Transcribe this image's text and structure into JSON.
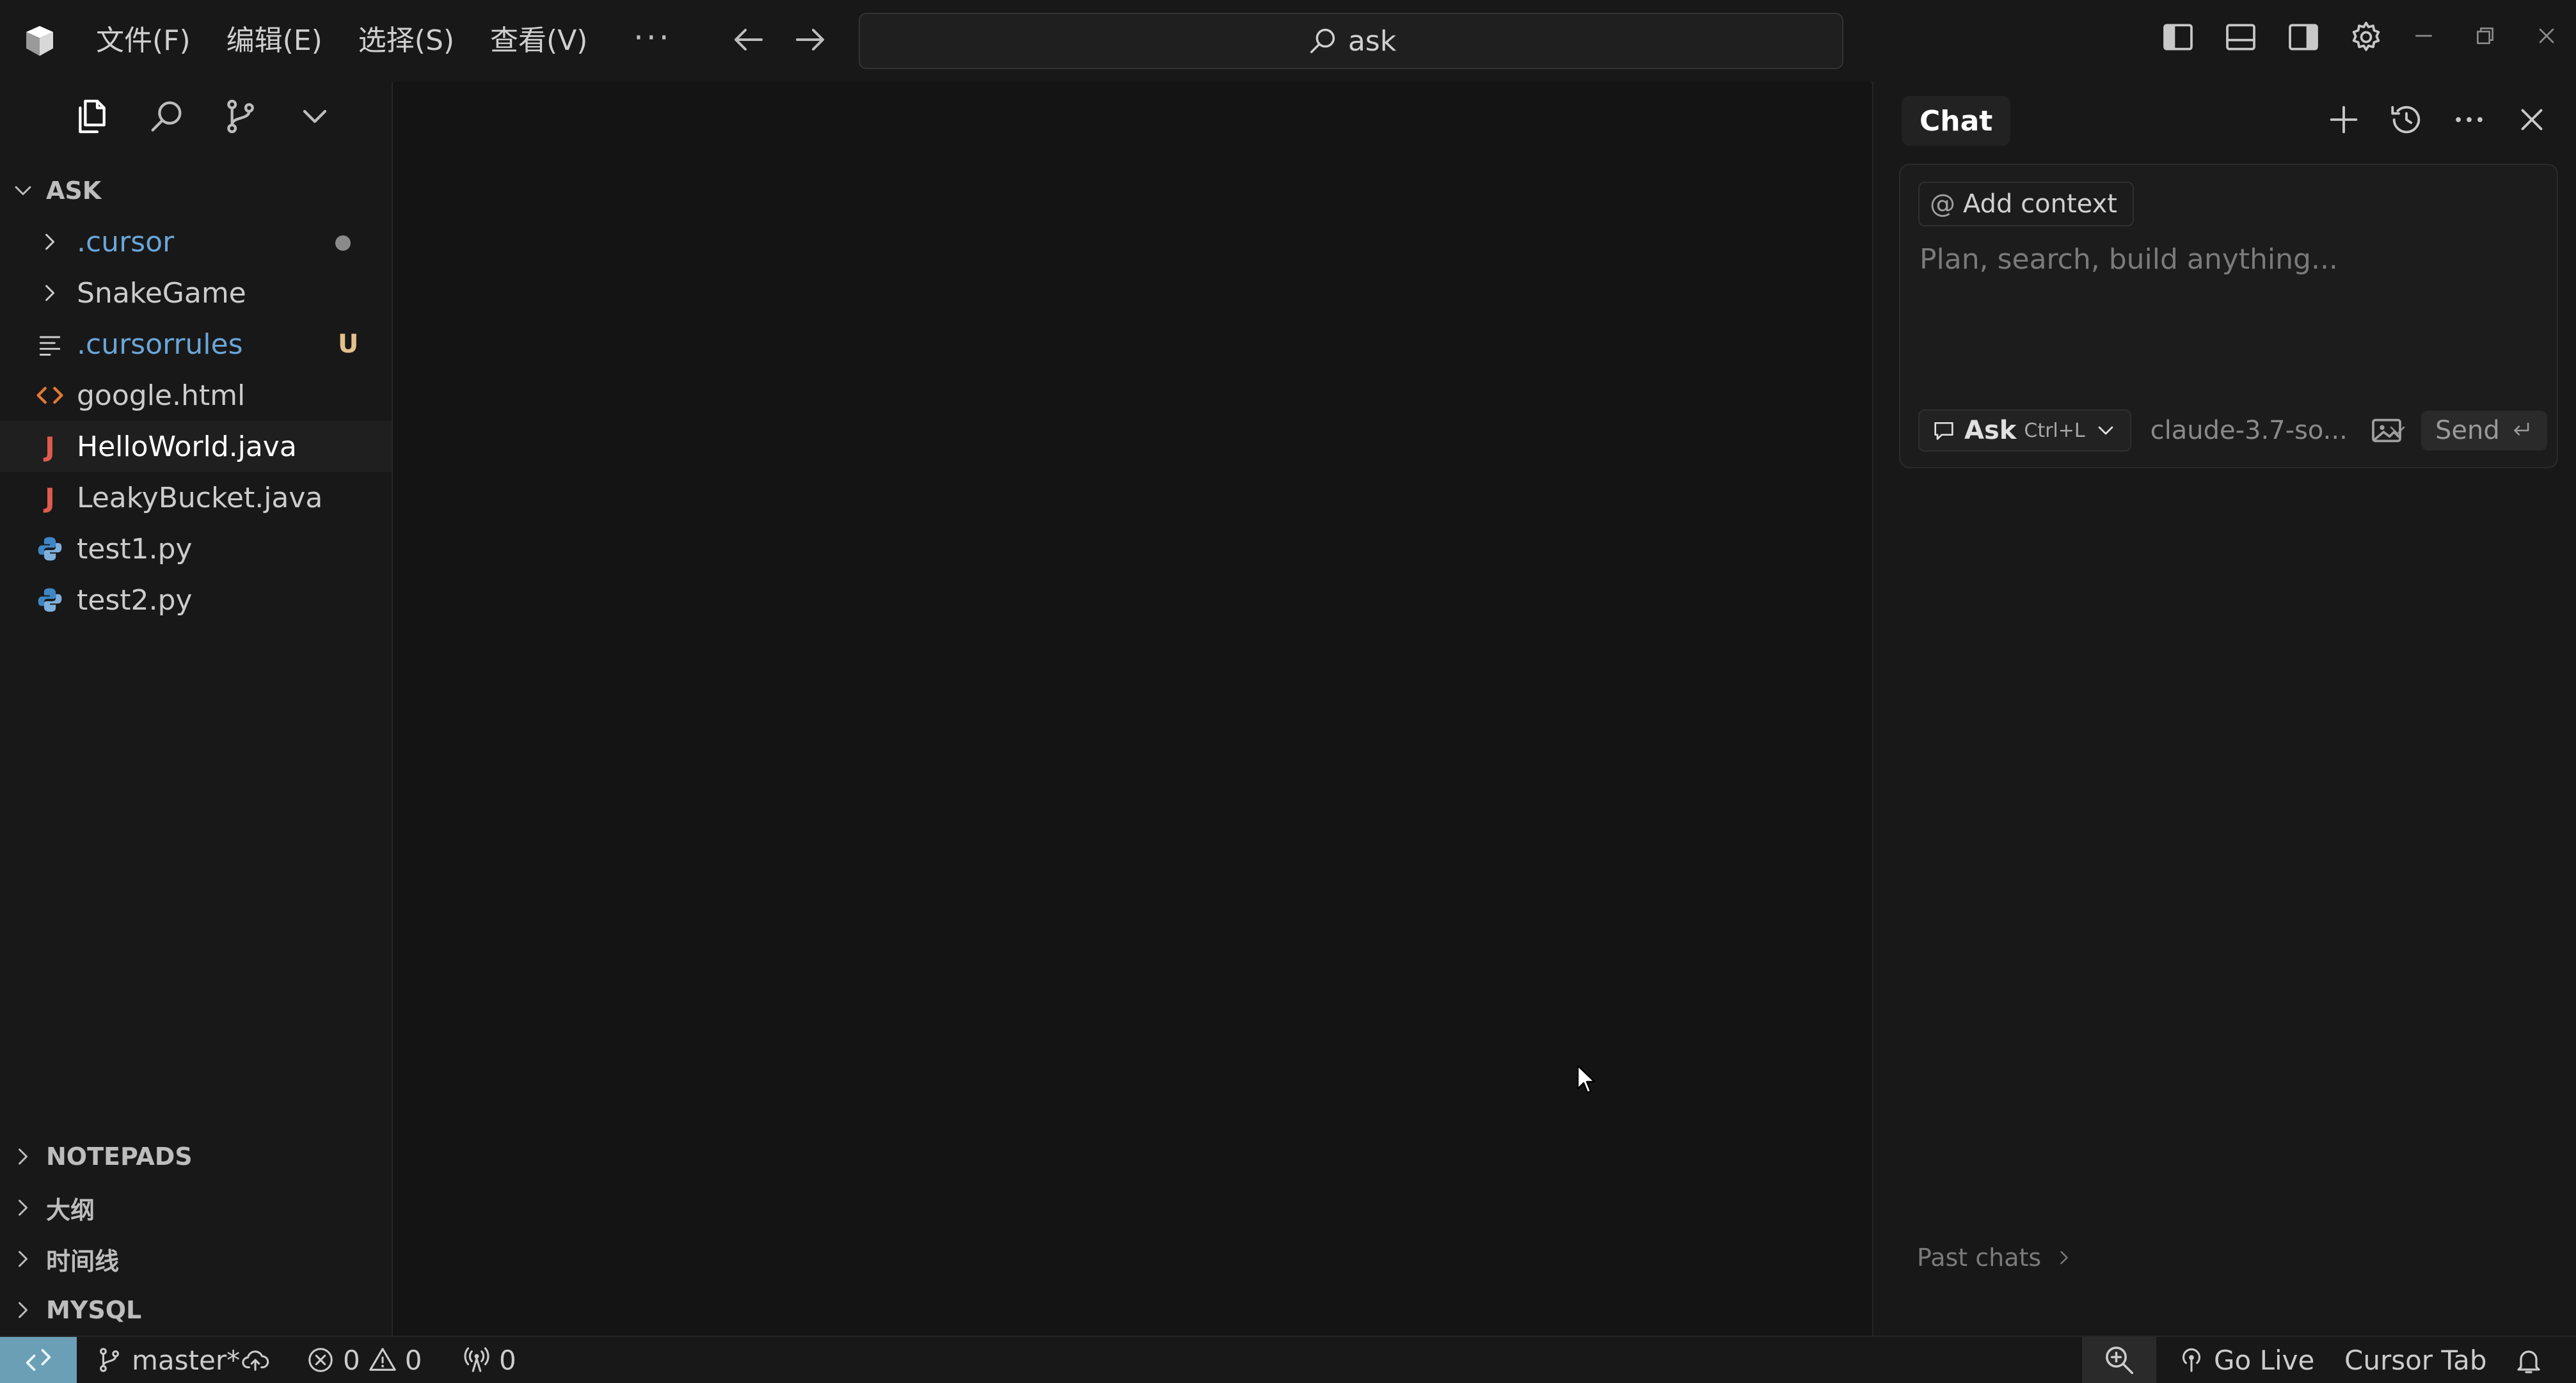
{
  "menu": [
    "文件(F)",
    "编辑(E)",
    "选择(S)",
    "查看(V)"
  ],
  "menu_more": "···",
  "search": {
    "text": "ask"
  },
  "explorer": {
    "title": "ASK",
    "items": [
      {
        "label": ".cursor",
        "kind": "folder",
        "color": "#6aa5d8",
        "status": "dot"
      },
      {
        "label": "SnakeGame",
        "kind": "folder",
        "color": "#cccccc"
      },
      {
        "label": ".cursorrules",
        "kind": "lines",
        "color": "#6aa5d8",
        "status": "U"
      },
      {
        "label": "google.html",
        "kind": "html",
        "color": "#cccccc"
      },
      {
        "label": "HelloWorld.java",
        "kind": "java",
        "color": "#ffffff",
        "selected": true
      },
      {
        "label": "LeakyBucket.java",
        "kind": "java",
        "color": "#cccccc"
      },
      {
        "label": "test1.py",
        "kind": "python",
        "color": "#cccccc"
      },
      {
        "label": "test2.py",
        "kind": "python",
        "color": "#cccccc"
      }
    ],
    "sections": [
      "NOTEPADS",
      "大纲",
      "时间线",
      "MYSQL"
    ]
  },
  "chat": {
    "tab": "Chat",
    "add_context": "Add context",
    "placeholder": "Plan, search, build anything...",
    "mode": "Ask",
    "mode_shortcut": "Ctrl+L",
    "model": "claude-3.7-so...",
    "send": "Send",
    "past_chats": "Past chats"
  },
  "status": {
    "branch": "master*",
    "errors": "0",
    "warnings": "0",
    "ports": "0",
    "go_live": "Go Live",
    "cursor_tab": "Cursor Tab"
  },
  "colors": {
    "accent_remote": "#6a9fb5",
    "html_icon": "#e37933",
    "java_icon": "#e05a4f",
    "python_icon": "#3f86c4",
    "badge_untracked": "#e2c08d"
  }
}
